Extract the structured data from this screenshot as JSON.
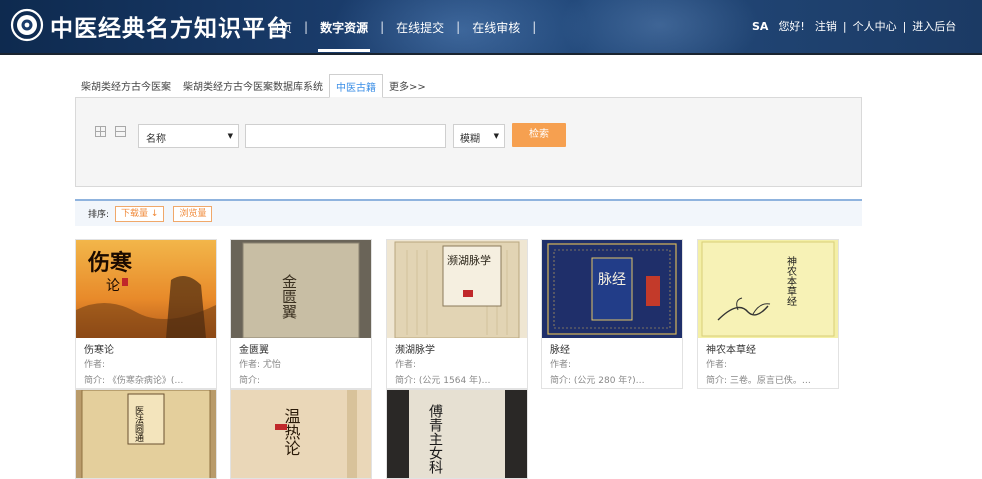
{
  "header": {
    "site_title": "中医经典名方知识平台",
    "nav": [
      {
        "label": "首页",
        "active": false
      },
      {
        "label": "数字资源",
        "active": true
      },
      {
        "label": "在线提交",
        "active": false
      },
      {
        "label": "在线审核",
        "active": false
      }
    ],
    "separator": "|",
    "user": {
      "name": "SA",
      "greeting": "您好!",
      "logout": "注销",
      "center": "个人中心",
      "admin": "进入后台",
      "separator": "|"
    }
  },
  "tabs": [
    {
      "label": "柴胡类经方古今医案",
      "active": false
    },
    {
      "label": "柴胡类经方古今医案数据库系统",
      "active": false
    },
    {
      "label": "中医古籍",
      "active": true
    },
    {
      "label": "更多>>",
      "active": false
    }
  ],
  "search": {
    "field": "名称",
    "keyword": "",
    "mode": "模糊",
    "button": "检索"
  },
  "sort": {
    "label": "排序:",
    "options": [
      "下载量 ↓",
      "浏览量"
    ]
  },
  "books": [
    {
      "title": "伤寒论",
      "author": "作者:",
      "summary": "简介: 《伤寒杂病论》(…"
    },
    {
      "title": "金匮翼",
      "author": "作者: 尤怡",
      "summary": "简介:"
    },
    {
      "title": "濒湖脉学",
      "author": "作者:",
      "summary": "简介: (公元 1564 年)…"
    },
    {
      "title": "脉经",
      "author": "作者:",
      "summary": "简介: (公元 280 年?)…"
    },
    {
      "title": "神农本草经",
      "author": "作者:",
      "summary": "简介: 三卷。原言已佚。…"
    }
  ],
  "partial_books": [
    {
      "cover_text": "医法圆通"
    },
    {
      "cover_text": "温热论"
    },
    {
      "cover_text": "傅青主女科"
    }
  ],
  "covers": {
    "shanghan": {
      "text_main": "伤寒",
      "text_sub": "论"
    },
    "jingui": {
      "text": "金匮翼"
    },
    "binhu": {
      "text": "濒湖脉学"
    },
    "maijing": {
      "text": "脉经"
    },
    "shennong": {
      "text": "神农本草经"
    }
  },
  "colors": {
    "accent_orange": "#f6a050",
    "tab_blue": "#3a8ee6",
    "header_navy": "#1a3c6b"
  }
}
